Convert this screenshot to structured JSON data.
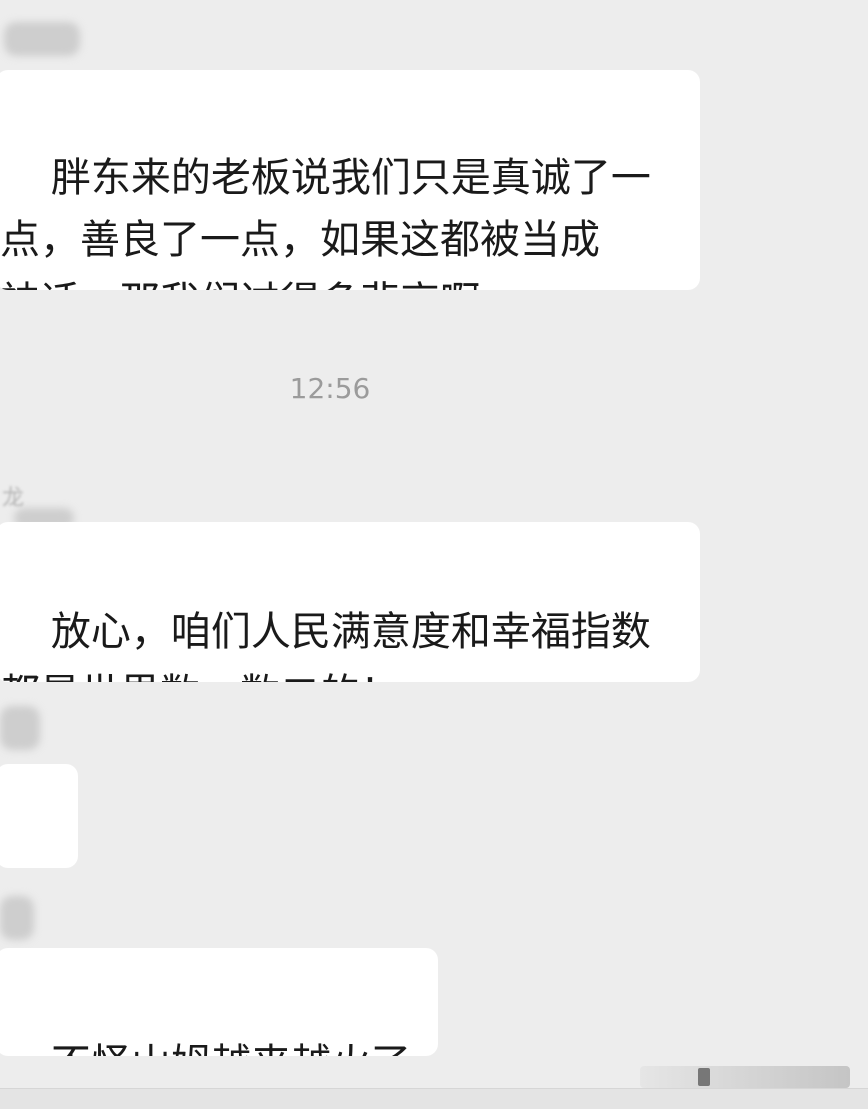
{
  "messages": [
    {
      "text": "胖东来的老板说我们只是真诚了一\n点，善良了一点，如果这都被当成\n神话，那我们过得多悲哀啊"
    },
    {
      "sender": "龙",
      "text": "放心，咱们人民满意度和幸福指数\n都是世界数一数二的！"
    },
    {
      "emoji": "grinning-face-emoji"
    },
    {
      "text": "不怪山姆越来越火了"
    }
  ],
  "timestamp": "12:56"
}
